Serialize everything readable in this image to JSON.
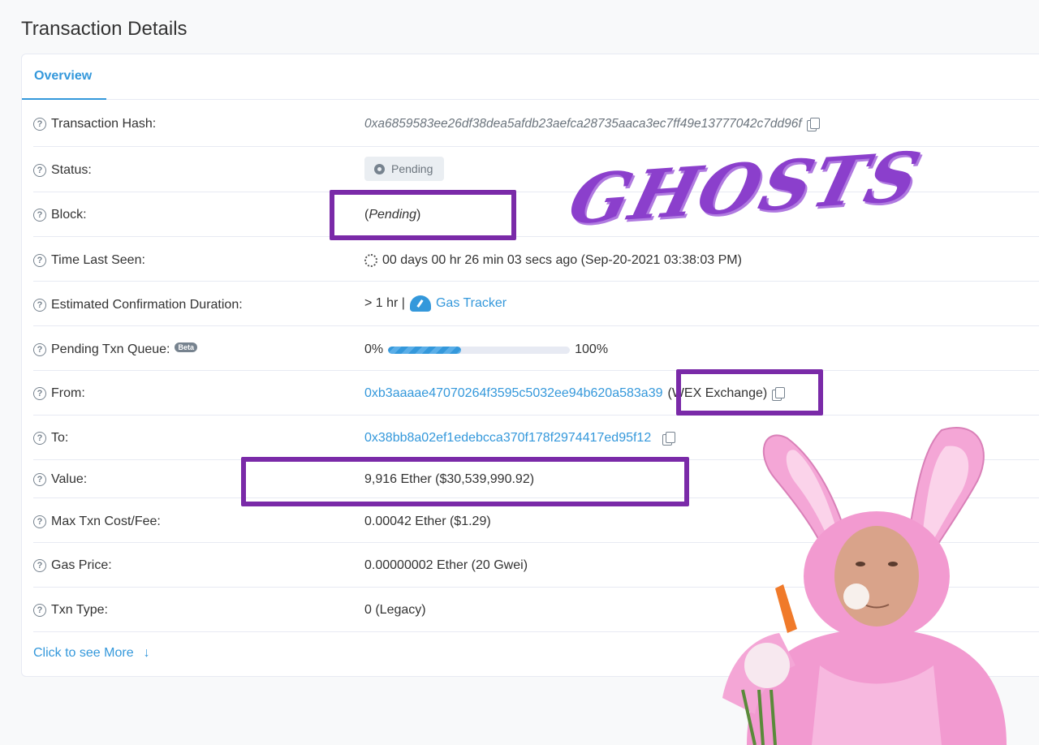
{
  "page": {
    "title": "Transaction Details"
  },
  "tabs": [
    {
      "label": "Overview"
    }
  ],
  "rows": {
    "hash": {
      "label": "Transaction Hash:",
      "value": "0xa6859583ee26df38dea5afdb23aefca28735aaca3ec7ff49e13777042c7dd96f"
    },
    "status": {
      "label": "Status:",
      "value": "Pending"
    },
    "block": {
      "label": "Block:",
      "open": "(",
      "value": "Pending",
      "close": ")"
    },
    "time": {
      "label": "Time Last Seen:",
      "value": "00 days 00 hr 26 min 03 secs ago (Sep-20-2021 03:38:03 PM)"
    },
    "duration": {
      "label": "Estimated Confirmation Duration:",
      "value": "> 1 hr |",
      "link": "Gas Tracker"
    },
    "queue": {
      "label": "Pending Txn Queue:",
      "badge": "Beta",
      "start": "0%",
      "end": "100%",
      "progress": 0.4
    },
    "from": {
      "label": "From:",
      "address": "0xb3aaaae47070264f3595c5032ee94b620a583a39",
      "name": "(WEX Exchange)"
    },
    "to": {
      "label": "To:",
      "address": "0x38bb8a02ef1edebcca370f178f2974417ed95f12"
    },
    "value": {
      "label": "Value:",
      "value": "9,916 Ether ($30,539,990.92)"
    },
    "fee": {
      "label": "Max Txn Cost/Fee:",
      "value": "0.00042 Ether ($1.29)"
    },
    "gas": {
      "label": "Gas Price:",
      "value": "0.00000002 Ether (20 Gwei)"
    },
    "type": {
      "label": "Txn Type:",
      "value": "0 (Legacy)"
    }
  },
  "more": {
    "label": "Click to see More"
  },
  "overlay": {
    "text": "GHOSTS",
    "color": "#8b3fcc",
    "highlight_color": "#7a2aa8"
  }
}
